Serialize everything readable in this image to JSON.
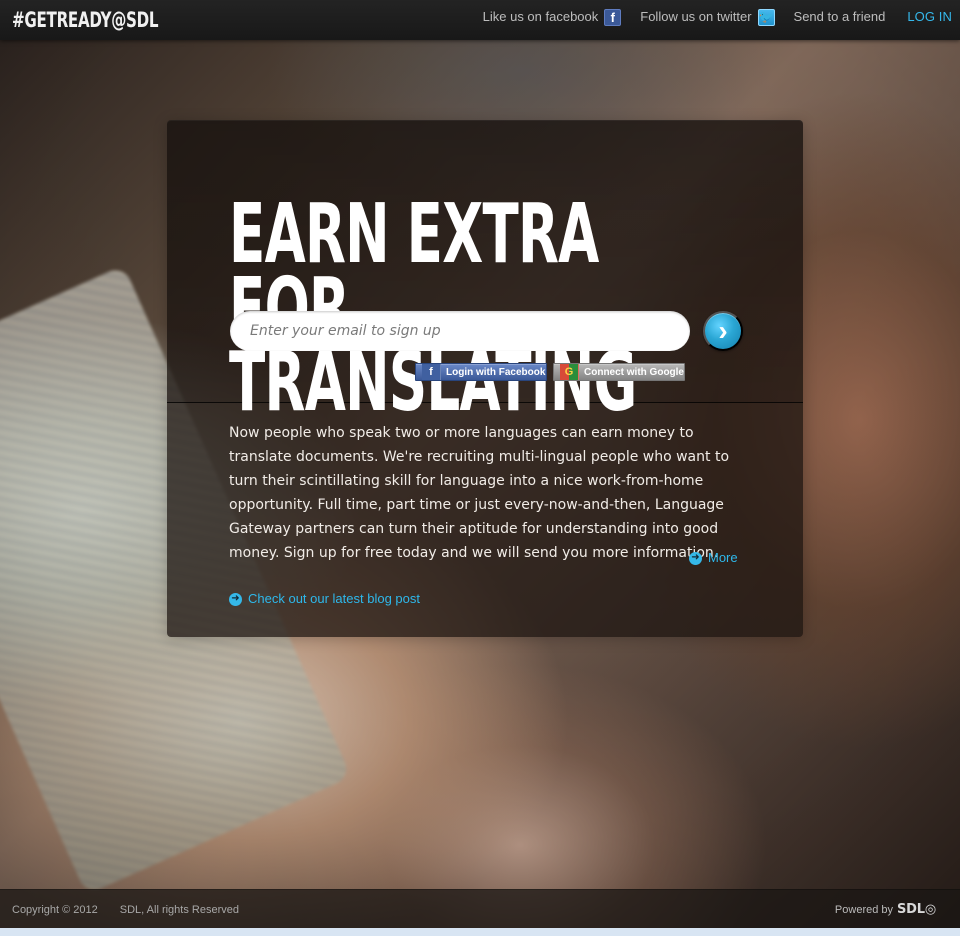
{
  "header": {
    "brand": "#GETREADY@SDL",
    "links": {
      "facebook": "Like us on facebook",
      "twitter": "Follow us on twitter",
      "send": "Send to a friend",
      "login": "LOG IN"
    },
    "icons": {
      "facebook": "f",
      "twitter": "🐦"
    }
  },
  "hero": {
    "headline_line1": "EARN EXTRA FOR",
    "headline_line2": "TRANSLATING",
    "email_placeholder": "Enter your email to sign up",
    "submit_symbol": "›",
    "social": {
      "facebook_label": "Login with Facebook",
      "google_label": "Connect with Google",
      "facebook_icon": "f",
      "google_icon": "G"
    }
  },
  "content": {
    "description": "Now people who speak two or more languages can earn money to translate documents. We're recruiting multi-lingual people who want to turn their scintillating skill for language into a nice work-from-home opportunity. Full time, part time or just every-now-and-then, Language Gateway partners can turn their aptitude for understanding into good money. Sign up for free today and we will send you more information.",
    "more": "More",
    "blog": "Check out our latest blog post",
    "arrow": "➜"
  },
  "footer": {
    "copyright": "Copyright © 2012",
    "rights": "SDL, All rights Reserved",
    "powered_by": "Powered by",
    "logo_text": "SDL◎"
  },
  "colors": {
    "accent": "#35b8eb",
    "header_bg": "#1f1f1f",
    "footer_bg": "#1c1715",
    "card_bg": "#221814"
  }
}
